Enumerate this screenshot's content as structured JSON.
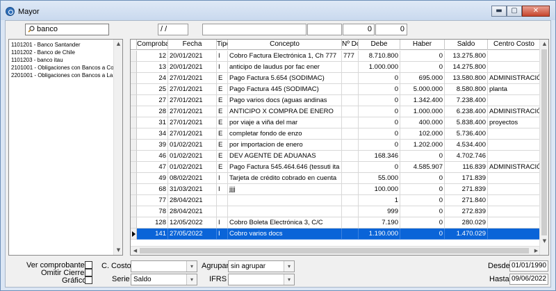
{
  "window": {
    "title": "Mayor",
    "controls": {
      "minimize": "▬",
      "maximize": "▢",
      "close": "✕"
    }
  },
  "toolbar": {
    "search_value": "banco",
    "date_value": "/ /",
    "text_value_1": "",
    "text_value_2": "",
    "number_1": "0",
    "number_2": "0"
  },
  "accounts": [
    "1101201 - Banco Santander",
    "1101202 - Banco de Chile",
    "1101203 - banco itau",
    "2101001 - Obligaciones con Bancos a Co",
    "2201001 - Obligaciones con Bancos a La"
  ],
  "grid": {
    "headers": [
      "Comprobar",
      "Fecha",
      "Tipo",
      "Concepto",
      "Nº Dc",
      "Debe",
      "Haber",
      "Saldo",
      "Centro Costo"
    ],
    "rows": [
      [
        "12",
        "20/01/2021",
        "I",
        "Cobro Factura Electrónica 1, Ch 777",
        "777",
        "8.710.800",
        "0",
        "13.275.800",
        ""
      ],
      [
        "13",
        "20/01/2021",
        "I",
        "anticipo de laudus por fac ener",
        "",
        "1.000.000",
        "0",
        "14.275.800",
        ""
      ],
      [
        "24",
        "27/01/2021",
        "E",
        "Pago Factura 5.654 (SODIMAC)",
        "",
        "0",
        "695.000",
        "13.580.800",
        "ADMINISTRACIÓN"
      ],
      [
        "25",
        "27/01/2021",
        "E",
        "Pago Factura 445 (SODIMAC)",
        "",
        "0",
        "5.000.000",
        "8.580.800",
        "planta"
      ],
      [
        "27",
        "27/01/2021",
        "E",
        "Pago varios docs (aguas andinas",
        "",
        "0",
        "1.342.400",
        "7.238.400",
        ""
      ],
      [
        "28",
        "27/01/2021",
        "E",
        "ANTICIPO X COMPRA DE ENERO",
        "",
        "0",
        "1.000.000",
        "6.238.400",
        "ADMINISTRACIÓN"
      ],
      [
        "31",
        "27/01/2021",
        "E",
        "por viaje a viña del mar",
        "",
        "0",
        "400.000",
        "5.838.400",
        "proyectos"
      ],
      [
        "34",
        "27/01/2021",
        "E",
        "completar fondo de enzo",
        "",
        "0",
        "102.000",
        "5.736.400",
        ""
      ],
      [
        "39",
        "01/02/2021",
        "E",
        "por importacion de enero",
        "",
        "0",
        "1.202.000",
        "4.534.400",
        ""
      ],
      [
        "46",
        "01/02/2021",
        "E",
        "DEV AGENTE DE ADUANAS",
        "",
        "168.346",
        "0",
        "4.702.746",
        ""
      ],
      [
        "47",
        "01/02/2021",
        "E",
        "Pago Factura 545.464.646 (tessuti ita",
        "",
        "0",
        "4.585.907",
        "116.839",
        "ADMINISTRACIÓN"
      ],
      [
        "49",
        "08/02/2021",
        "I",
        "Tarjeta de crédito  cobrado en cuenta",
        "",
        "55.000",
        "0",
        "171.839",
        ""
      ],
      [
        "68",
        "31/03/2021",
        "I",
        "jjjj",
        "",
        "100.000",
        "0",
        "271.839",
        ""
      ],
      [
        "77",
        "28/04/2021",
        "",
        "",
        "",
        "1",
        "0",
        "271.840",
        ""
      ],
      [
        "78",
        "28/04/2021",
        "",
        "",
        "",
        "999",
        "0",
        "272.839",
        ""
      ],
      [
        "128",
        "12/05/2022",
        "I",
        "Cobro Boleta Electrónica 3, C/C",
        "",
        "7.190",
        "0",
        "280.029",
        ""
      ],
      [
        "141",
        "27/05/2022",
        "I",
        "Cobro varios docs",
        "",
        "1.190.000",
        "0",
        "1.470.029",
        ""
      ]
    ],
    "selected_row": 16
  },
  "footer": {
    "ver_comprobantes": "Ver comprobantes",
    "omitir_cierres": "Omitir Cierres",
    "grafico": "Gráfico",
    "c_costo_label": "C. Costo",
    "c_costo_value": "",
    "serie_label": "Serie",
    "serie_value": "Saldo",
    "agrupar_label": "Agrupar",
    "agrupar_value": "sin agrupar",
    "ifrs_label": "IFRS",
    "ifrs_value": "",
    "desde_label": "Desde",
    "desde_value": "01/01/1990",
    "hasta_label": "Hasta",
    "hasta_value": "09/06/2022"
  },
  "icons": {
    "search": "magnifier-icon",
    "dropdown": "▾",
    "up": "▲",
    "down": "▼",
    "left": "◀",
    "right": "▶"
  }
}
